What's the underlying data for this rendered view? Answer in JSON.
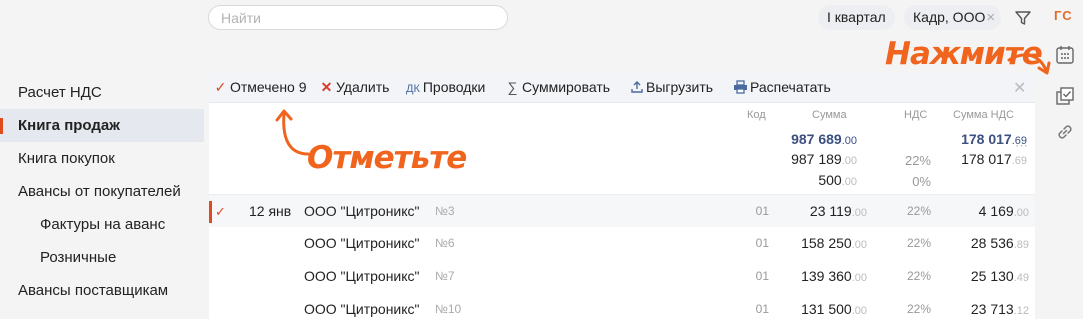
{
  "search": {
    "placeholder": "Найти",
    "value": ""
  },
  "filters": {
    "quarter": "I квартал",
    "org": "Кадр, ООО",
    "user_initials": "ГС"
  },
  "sidebar": {
    "items": [
      {
        "label": "Расчет НДС"
      },
      {
        "label": "Книга продаж"
      },
      {
        "label": "Книга покупок"
      },
      {
        "label": "Авансы от покупателей"
      },
      {
        "label": "Фактуры на аванс"
      },
      {
        "label": "Розничные"
      },
      {
        "label": "Авансы поставщикам"
      }
    ]
  },
  "toolbar": {
    "marked": "Отмечено 9",
    "delete": "Удалить",
    "postings_icon": "ДК",
    "postings": "Проводки",
    "sum": "Суммировать",
    "export": "Выгрузить",
    "print": "Распечатать"
  },
  "table": {
    "headers": {
      "code": "Код",
      "sum": "Сумма",
      "vat": "НДС",
      "vat_sum": "Сумма НДС"
    },
    "totals": [
      {
        "sum": "987 689",
        "sum_dec": ".00",
        "vat": "",
        "vat_sum": "178 017",
        "vat_sum_dec": ".69"
      },
      {
        "sum": "987 189",
        "sum_dec": ".00",
        "vat": "22%",
        "vat_sum": "178 017",
        "vat_sum_dec": ".69"
      },
      {
        "sum": "500",
        "sum_dec": ".00",
        "vat": "0%",
        "vat_sum": "",
        "vat_sum_dec": ""
      }
    ],
    "rows": [
      {
        "date": "12 янв",
        "org": "ООО \"Цитроникс\"",
        "num": "№3",
        "code": "01",
        "sum": "23 119",
        "sum_dec": ".00",
        "rate": "22%",
        "vat_sum": "4 169",
        "vat_sum_dec": ".00"
      },
      {
        "date": "",
        "org": "ООО \"Цитроникс\"",
        "num": "№6",
        "code": "01",
        "sum": "158 250",
        "sum_dec": ".00",
        "rate": "22%",
        "vat_sum": "28 536",
        "vat_sum_dec": ".89"
      },
      {
        "date": "",
        "org": "ООО \"Цитроникс\"",
        "num": "№7",
        "code": "01",
        "sum": "139 360",
        "sum_dec": ".00",
        "rate": "22%",
        "vat_sum": "25 130",
        "vat_sum_dec": ".49"
      },
      {
        "date": "",
        "org": "ООО \"Цитроникс\"",
        "num": "№10",
        "code": "01",
        "sum": "131 500",
        "sum_dec": ".00",
        "rate": "22%",
        "vat_sum": "23 713",
        "vat_sum_dec": ".12"
      }
    ]
  },
  "callouts": {
    "press": "Нажмите",
    "mark": "Отметьте"
  },
  "colors": {
    "accent": "#e04a1f",
    "callout": "#f0641e",
    "total": "#3c4f82"
  },
  "icons": [
    "filter-icon",
    "calendar-icon",
    "check-list-icon",
    "link-icon",
    "close-icon",
    "upload-icon",
    "printer-icon",
    "sigma-icon"
  ]
}
